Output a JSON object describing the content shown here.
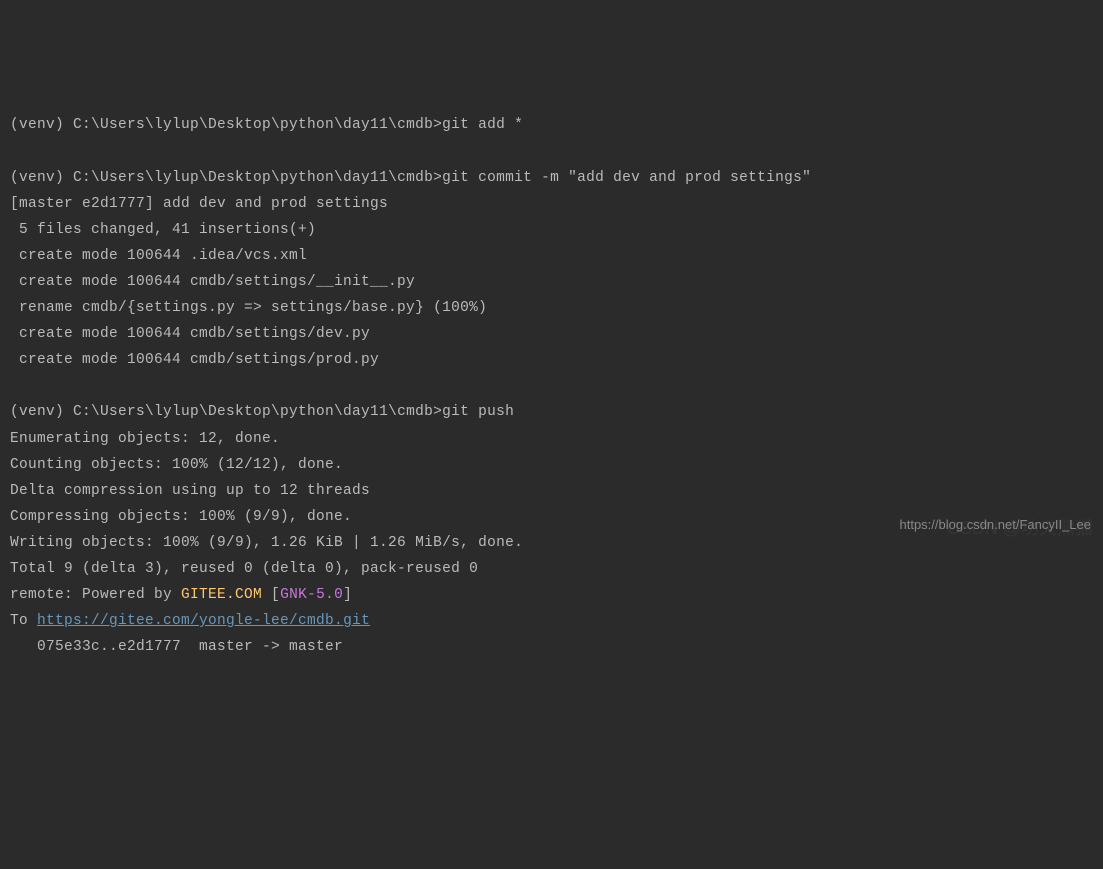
{
  "lines": [
    {
      "type": "prompt",
      "env": "(venv) ",
      "path": "C:\\Users\\lylup\\Desktop\\python\\day11\\cmdb>",
      "cmd": "git add *"
    },
    {
      "type": "blank"
    },
    {
      "type": "prompt",
      "env": "(venv) ",
      "path": "C:\\Users\\lylup\\Desktop\\python\\day11\\cmdb>",
      "cmd": "git commit -m \"add dev and prod settings\""
    },
    {
      "type": "text",
      "text": "[master e2d1777] add dev and prod settings"
    },
    {
      "type": "text",
      "text": " 5 files changed, 41 insertions(+)"
    },
    {
      "type": "text",
      "text": " create mode 100644 .idea/vcs.xml"
    },
    {
      "type": "text",
      "text": " create mode 100644 cmdb/settings/__init__.py"
    },
    {
      "type": "text",
      "text": " rename cmdb/{settings.py => settings/base.py} (100%)"
    },
    {
      "type": "text",
      "text": " create mode 100644 cmdb/settings/dev.py"
    },
    {
      "type": "text",
      "text": " create mode 100644 cmdb/settings/prod.py"
    },
    {
      "type": "blank"
    },
    {
      "type": "prompt",
      "env": "(venv) ",
      "path": "C:\\Users\\lylup\\Desktop\\python\\day11\\cmdb>",
      "cmd": "git push"
    },
    {
      "type": "text",
      "text": "Enumerating objects: 12, done."
    },
    {
      "type": "text",
      "text": "Counting objects: 100% (12/12), done."
    },
    {
      "type": "text",
      "text": "Delta compression using up to 12 threads"
    },
    {
      "type": "text",
      "text": "Compressing objects: 100% (9/9), done."
    },
    {
      "type": "text",
      "text": "Writing objects: 100% (9/9), 1.26 KiB | 1.26 MiB/s, done."
    },
    {
      "type": "text",
      "text": "Total 9 (delta 3), reused 0 (delta 0), pack-reused 0"
    },
    {
      "type": "remote",
      "prefix": "remote: Powered by ",
      "yellow": "GITEE.COM",
      "mid": " [",
      "pink": "GNK-5.0",
      "suffix": "]"
    },
    {
      "type": "linkline",
      "prefix": "To ",
      "link": "https://gitee.com/yongle-lee/cmdb.git"
    },
    {
      "type": "text",
      "text": "   075e33c..e2d1777  master -> master"
    }
  ],
  "watermark": "https://blog.csdn.net/FancyII_Lee",
  "watermark_bg": "CSDN @功夫熊猫"
}
